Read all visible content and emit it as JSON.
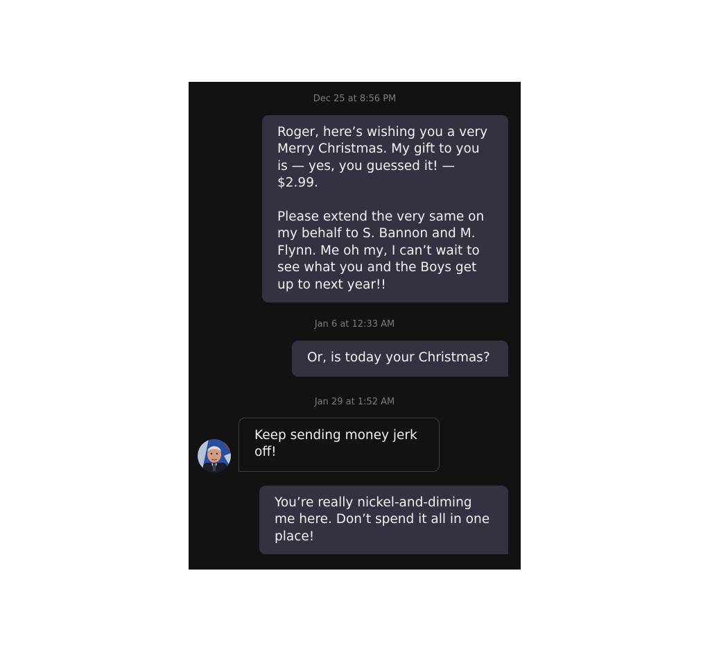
{
  "conversation": {
    "messages": [
      {
        "timestamp": "Dec 25 at 8:56 PM",
        "direction": "outgoing",
        "text": "Roger, here’s wishing you a very\nMerry Christmas. My gift to you\nis — yes, you guessed it! —\n$2.99.\n\nPlease extend the very same on\nmy behalf to S. Bannon and M.\nFlynn. Me oh my, I can’t wait to\nsee what you and the Boys get\nup to next year!!"
      },
      {
        "timestamp": "Jan 6 at 12:33 AM",
        "direction": "outgoing",
        "text": "Or, is today your Christmas?"
      },
      {
        "timestamp": "Jan 29 at 1:52 AM",
        "direction": "incoming",
        "avatar_icon": "profile-photo-avatar",
        "text": "Keep sending money jerk\noff!"
      },
      {
        "direction": "outgoing",
        "text": "You’re really nickel-and-diming\nme here. Don’t spend it all in one\nplace!"
      }
    ]
  },
  "colors": {
    "panel_background": "#121212",
    "outgoing_bubble": "#323240",
    "incoming_border": "#3e3e46",
    "message_text": "#f2f2f4",
    "timestamp_text": "#7b7b7f"
  }
}
